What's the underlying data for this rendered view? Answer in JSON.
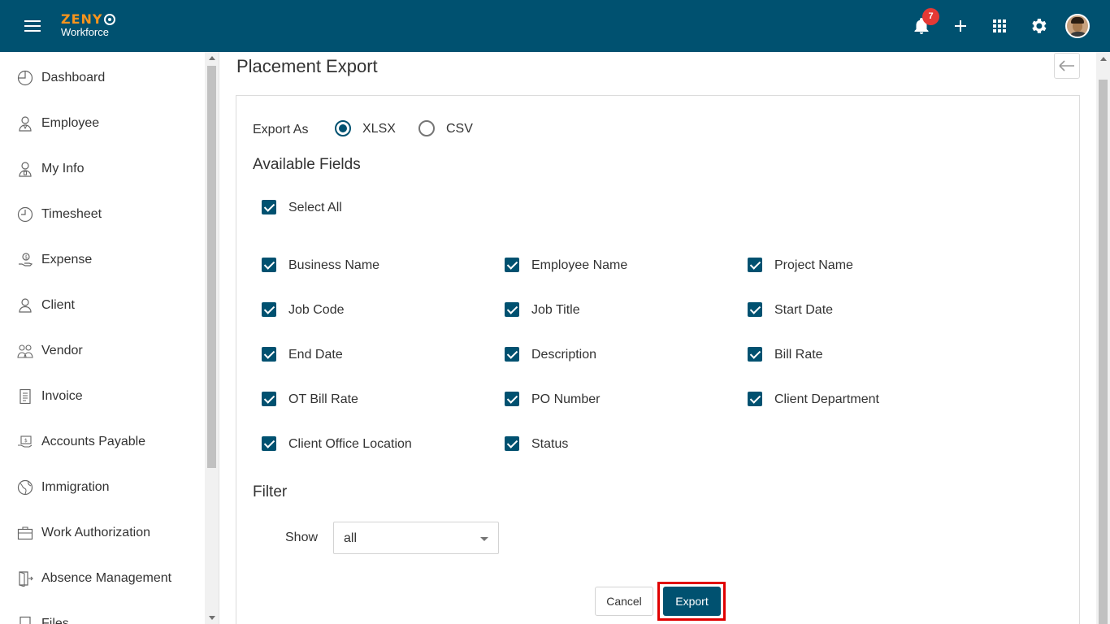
{
  "header": {
    "logo_top": "ZENY",
    "logo_bottom": "Workforce",
    "notification_count": "7",
    "icons": [
      "menu-icon",
      "bell-icon",
      "plus-icon",
      "apps-grid-icon",
      "gear-icon",
      "avatar"
    ]
  },
  "sidebar": {
    "items": [
      {
        "label": "Dashboard",
        "icon": "dashboard-icon"
      },
      {
        "label": "Employee",
        "icon": "employee-icon"
      },
      {
        "label": "My Info",
        "icon": "my-info-icon"
      },
      {
        "label": "Timesheet",
        "icon": "clock-icon"
      },
      {
        "label": "Expense",
        "icon": "expense-icon"
      },
      {
        "label": "Client",
        "icon": "person-icon"
      },
      {
        "label": "Vendor",
        "icon": "vendor-icon"
      },
      {
        "label": "Invoice",
        "icon": "invoice-icon"
      },
      {
        "label": "Accounts Payable",
        "icon": "accounts-payable-icon"
      },
      {
        "label": "Immigration",
        "icon": "globe-icon"
      },
      {
        "label": "Work Authorization",
        "icon": "briefcase-icon"
      },
      {
        "label": "Absence Management",
        "icon": "exit-door-icon"
      },
      {
        "label": "Files",
        "icon": "files-icon"
      }
    ]
  },
  "main": {
    "title": "Placement Export",
    "export_as": {
      "label": "Export As",
      "options": [
        "XLSX",
        "CSV"
      ],
      "selected": "XLSX"
    },
    "available_fields": {
      "heading": "Available Fields",
      "select_all": "Select All",
      "fields": [
        "Business Name",
        "Employee Name",
        "Project Name",
        "Job Code",
        "Job Title",
        "Start Date",
        "End Date",
        "Description",
        "Bill Rate",
        "OT Bill Rate",
        "PO Number",
        "Client Department",
        "Client Office Location",
        "Status"
      ]
    },
    "filter": {
      "heading": "Filter",
      "show_label": "Show",
      "show_value": "all"
    },
    "buttons": {
      "cancel": "Cancel",
      "export": "Export"
    }
  },
  "colors": {
    "primary": "#005170",
    "accent": "#f7941d",
    "highlight": "#e00000",
    "badge": "#e53935"
  }
}
